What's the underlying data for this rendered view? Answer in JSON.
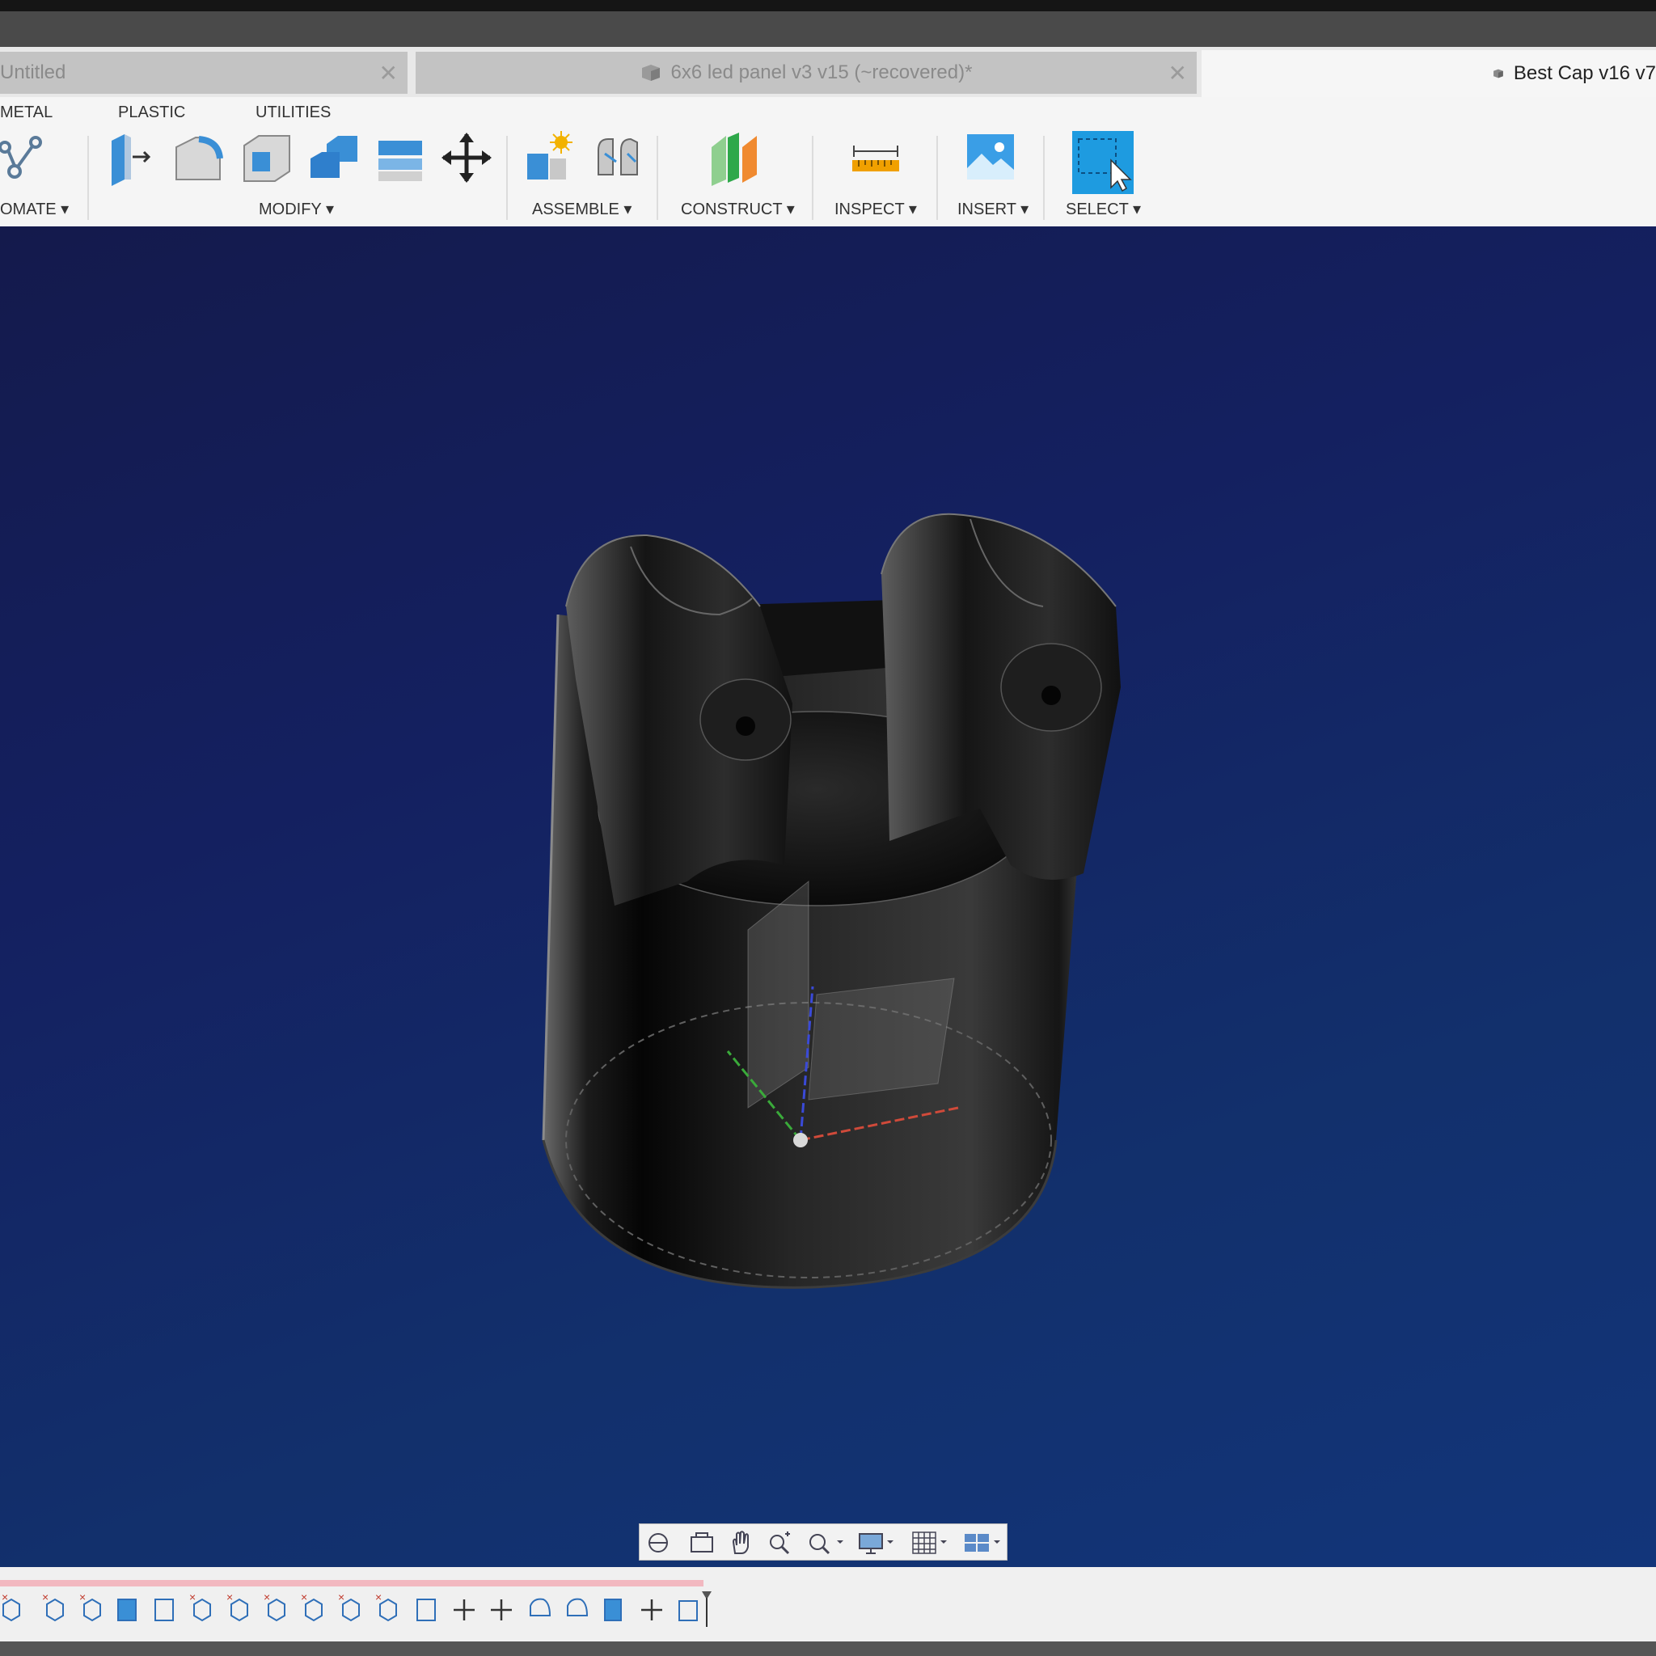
{
  "tabs": [
    {
      "label": "Untitled",
      "active": false
    },
    {
      "label": "6x6 led panel v3 v15 (~recovered)*",
      "active": false
    },
    {
      "label": "Best Cap v16 v7",
      "active": true
    }
  ],
  "ribbon": {
    "tabs": [
      "METAL",
      "PLASTIC",
      "UTILITIES"
    ],
    "groups": [
      "OMATE ▾",
      "MODIFY ▾",
      "ASSEMBLE ▾",
      "CONSTRUCT ▾",
      "INSPECT ▾",
      "INSERT ▾",
      "SELECT ▾"
    ]
  },
  "colors": {
    "viewport_top": "#141a4c",
    "viewport_bottom": "#12357a",
    "select_accent": "#1e9be0",
    "inspect_accent": "#f0a000"
  },
  "icons": {
    "modify": [
      "press-pull-icon",
      "fillet-icon",
      "shell-icon",
      "combine-icon",
      "replace-face-icon",
      "move-icon"
    ],
    "assemble": [
      "new-component-icon",
      "joint-icon"
    ],
    "navbar": [
      "orbit-icon",
      "look-at-icon",
      "pan-icon",
      "zoom-icon",
      "fit-icon",
      "display-settings-icon",
      "grid-icon",
      "viewports-icon"
    ]
  }
}
